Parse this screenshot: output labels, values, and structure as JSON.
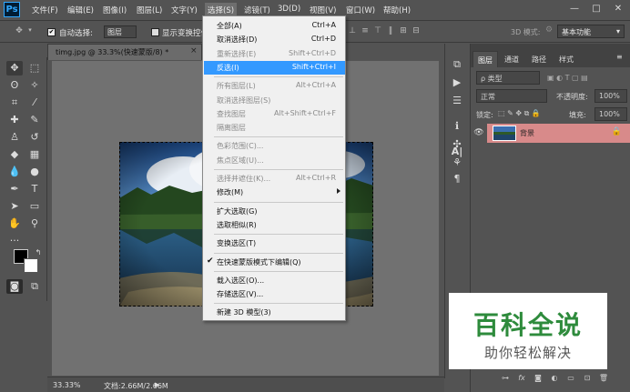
{
  "app": {
    "logo": "Ps"
  },
  "menubar": {
    "items": [
      "文件(F)",
      "编辑(E)",
      "图像(I)",
      "图层(L)",
      "文字(Y)",
      "选择(S)",
      "滤镜(T)",
      "3D(D)",
      "视图(V)",
      "窗口(W)",
      "帮助(H)"
    ],
    "active_index": 5,
    "window_controls": [
      "—",
      "□",
      "✕"
    ]
  },
  "options_bar": {
    "auto_select_label": "自动选择:",
    "auto_select_checked": true,
    "auto_select_target": "图层",
    "show_transform_label": "显示变换控件",
    "mode_3d_label": "3D 模式:",
    "workspace": "基本功能"
  },
  "document": {
    "tab_title": "timg.jpg @ 33.3%(快速蒙版/8) *",
    "zoom": "33.33%",
    "doc_size": "文档:2.66M/2.66M"
  },
  "select_menu": {
    "items": [
      {
        "label": "全部(A)",
        "shortcut": "Ctrl+A",
        "disabled": false
      },
      {
        "label": "取消选择(D)",
        "shortcut": "Ctrl+D",
        "disabled": false
      },
      {
        "label": "重新选择(E)",
        "shortcut": "Shift+Ctrl+D",
        "disabled": true
      },
      {
        "label": "反选(I)",
        "shortcut": "Shift+Ctrl+I",
        "disabled": false,
        "highlighted": true
      },
      {
        "sep": true
      },
      {
        "label": "所有图层(L)",
        "shortcut": "Alt+Ctrl+A",
        "disabled": true
      },
      {
        "label": "取消选择图层(S)",
        "shortcut": "",
        "disabled": true
      },
      {
        "label": "查找图层",
        "shortcut": "Alt+Shift+Ctrl+F",
        "disabled": true
      },
      {
        "label": "隔离图层",
        "shortcut": "",
        "disabled": true
      },
      {
        "sep": true
      },
      {
        "label": "色彩范围(C)...",
        "shortcut": "",
        "disabled": true
      },
      {
        "label": "焦点区域(U)...",
        "shortcut": "",
        "disabled": true
      },
      {
        "sep": true
      },
      {
        "label": "选择并遮住(K)...",
        "shortcut": "Alt+Ctrl+R",
        "disabled": true
      },
      {
        "label": "修改(M)",
        "shortcut": "",
        "disabled": false,
        "submenu": true
      },
      {
        "sep": true
      },
      {
        "label": "扩大选取(G)",
        "shortcut": "",
        "disabled": false
      },
      {
        "label": "选取相似(R)",
        "shortcut": "",
        "disabled": false
      },
      {
        "sep": true
      },
      {
        "label": "变换选区(T)",
        "shortcut": "",
        "disabled": false
      },
      {
        "sep": true
      },
      {
        "label": "在快速蒙版模式下编辑(Q)",
        "shortcut": "",
        "disabled": false,
        "checked": true
      },
      {
        "sep": true
      },
      {
        "label": "载入选区(O)...",
        "shortcut": "",
        "disabled": false
      },
      {
        "label": "存储选区(V)...",
        "shortcut": "",
        "disabled": false
      },
      {
        "sep": true
      },
      {
        "label": "新建 3D 模型(3)",
        "shortcut": "",
        "disabled": false
      }
    ]
  },
  "layers_panel": {
    "tabs": [
      "图层",
      "通道",
      "路径",
      "样式"
    ],
    "active_tab": 0,
    "filter": "ρ 类型",
    "blend_mode": "正常",
    "opacity_label": "不透明度:",
    "opacity": "100%",
    "lock_label": "锁定:",
    "fill_label": "填充:",
    "fill": "100%",
    "layers": [
      {
        "name": "背景",
        "locked": true,
        "visible": true
      }
    ],
    "bottom_icons": [
      "link-icon",
      "fx-icon",
      "mask-icon",
      "adjustment-icon",
      "folder-icon",
      "new-layer-icon",
      "trash-icon"
    ]
  },
  "watermark": {
    "title": "百科全说",
    "subtitle": "助你轻松解决"
  },
  "colors": {
    "menu_highlight": "#3399ff",
    "layer_selected": "#d88a8a",
    "watermark_green": "#2e8b3c"
  }
}
